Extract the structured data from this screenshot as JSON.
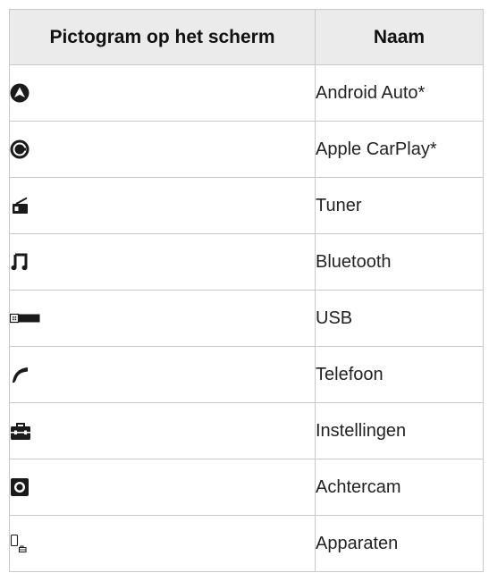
{
  "table": {
    "headers": {
      "icon_column": "Pictogram op het scherm",
      "name_column": "Naam"
    },
    "rows": [
      {
        "icon": "android-auto-icon",
        "name": "Android Auto*"
      },
      {
        "icon": "apple-carplay-icon",
        "name": "Apple CarPlay*"
      },
      {
        "icon": "tuner-radio-icon",
        "name": "Tuner"
      },
      {
        "icon": "bluetooth-music-note-icon",
        "name": "Bluetooth"
      },
      {
        "icon": "usb-icon",
        "name": "USB"
      },
      {
        "icon": "telephone-handset-icon",
        "name": "Telefoon"
      },
      {
        "icon": "toolbox-settings-icon",
        "name": "Instellingen"
      },
      {
        "icon": "rear-camera-icon",
        "name": "Achtercam"
      },
      {
        "icon": "devices-icon",
        "name": "Apparaten"
      }
    ]
  }
}
